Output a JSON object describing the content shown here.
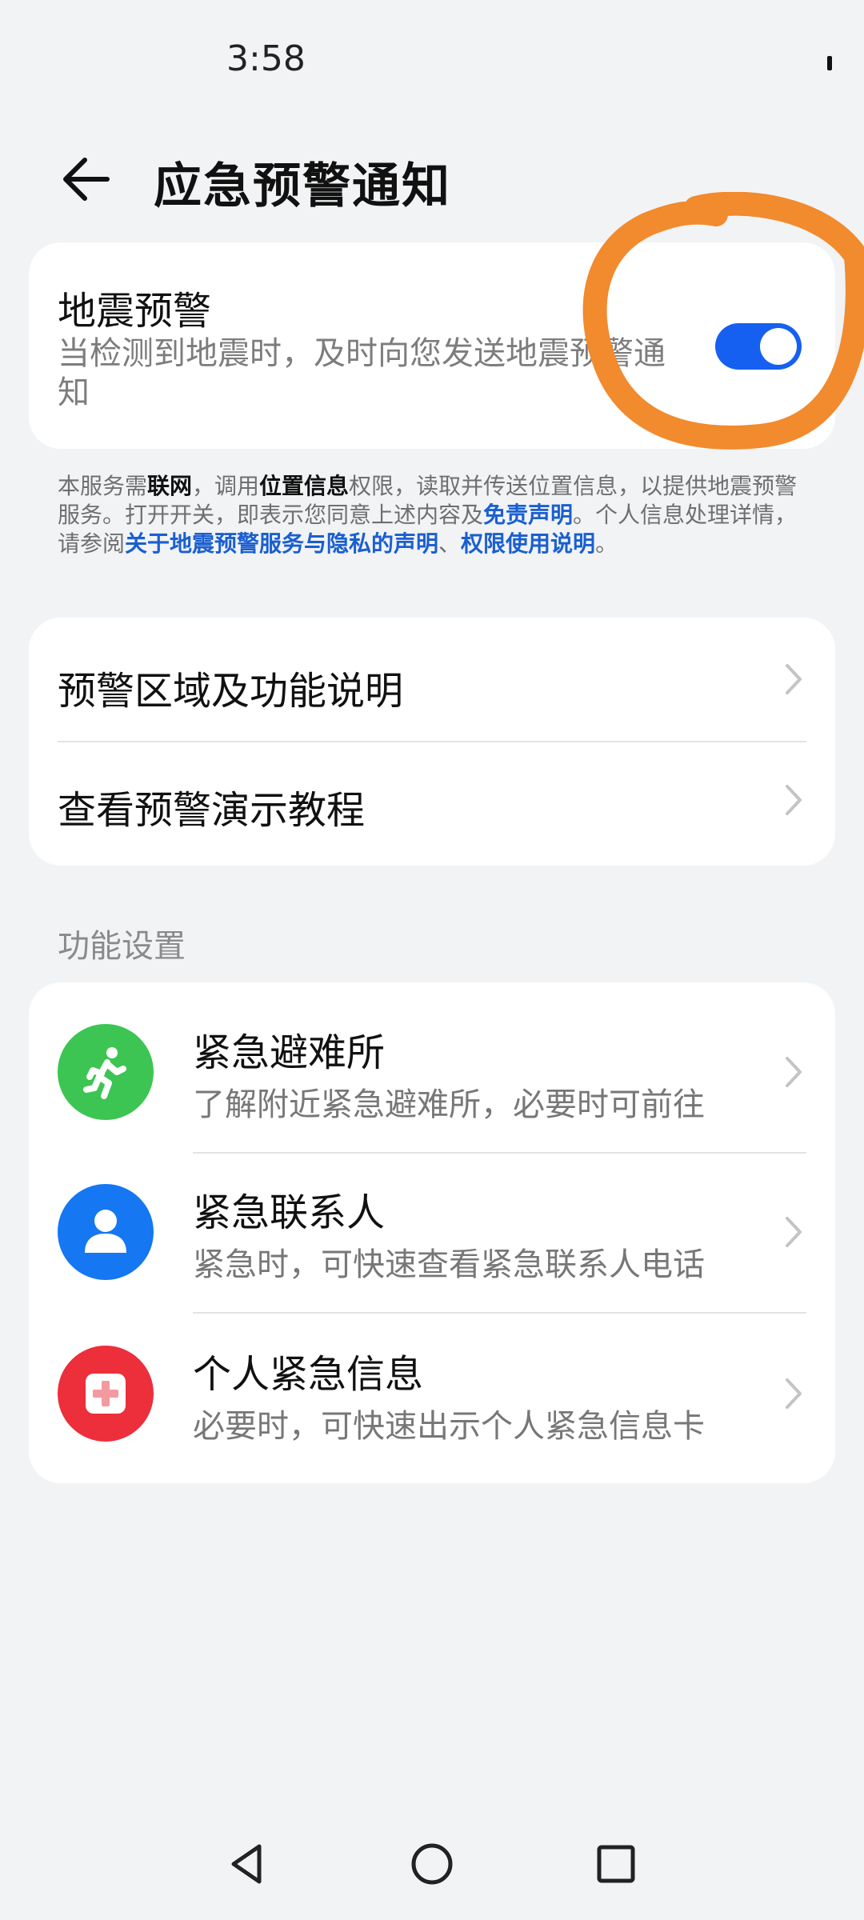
{
  "status_bar": {
    "time": "3:58"
  },
  "header": {
    "title": "应急预警通知"
  },
  "earthquake": {
    "title": "地震预警",
    "description": "当检测到地震时，及时向您发送地震预警通知",
    "enabled": true
  },
  "notice": {
    "t1": "本服务需",
    "b1": "联网",
    "t2": "，调用",
    "b2": "位置信息",
    "t3": "权限，读取并传送位置信息，以提供地震预警服务。打开开关，即表示您同意上述内容及",
    "l1": "免责声明",
    "t4": "。个人信息处理详情，请参阅",
    "l2": "关于地震预警服务与隐私的声明",
    "t5": "、",
    "l3": "权限使用说明",
    "t6": "。"
  },
  "links": [
    {
      "label": "预警区域及功能说明"
    },
    {
      "label": "查看预警演示教程"
    }
  ],
  "section_title": "功能设置",
  "features": [
    {
      "title": "紧急避难所",
      "subtitle": "了解附近紧急避难所，必要时可前往",
      "icon": "running-person-icon",
      "color": "#3cc552"
    },
    {
      "title": "紧急联系人",
      "subtitle": "紧急时，可快速查看紧急联系人电话",
      "icon": "person-icon",
      "color": "#1577f2"
    },
    {
      "title": "个人紧急信息",
      "subtitle": "必要时，可快速出示个人紧急信息卡",
      "icon": "medical-cross-icon",
      "color": "#ec2f3b"
    }
  ],
  "colors": {
    "accent": "#1560f0",
    "annotation": "#f28a2e",
    "background": "#f1f3f5"
  }
}
